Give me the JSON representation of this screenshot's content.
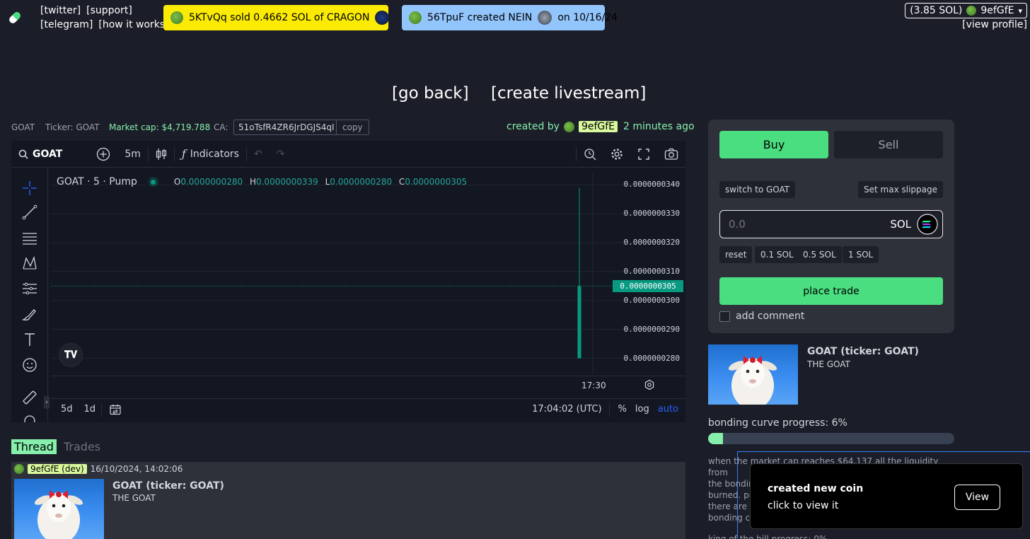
{
  "nav": {
    "links_row1": [
      "[twitter]",
      "[support]"
    ],
    "links_row2": [
      "[telegram]",
      "[how it works]"
    ],
    "ticker_sale": {
      "text": "5KTvQq  sold 0.4662 SOL of CRAGON",
      "bg": "#fbeb04"
    },
    "ticker_create": {
      "text": "56TpuF created NEIN",
      "date": "on 10/16/24",
      "bg": "#93c5fd"
    },
    "wallet": {
      "balance": "(3.85 SOL)",
      "user": "9efGfE",
      "caret": "▾"
    },
    "view_profile": "[view profile]"
  },
  "actions": {
    "go_back": "[go back]",
    "create_livestream": "[create livestream]"
  },
  "coin": {
    "name": "GOAT",
    "ticker_label": "Ticker: GOAT",
    "market_cap": "Market cap: $4,719.788",
    "ca_label": "CA:",
    "ca_value": "51oTsfR4ZR6JrDGJS4qI",
    "copy_label": "copy",
    "created_by": "created by",
    "creator": "9efGfE",
    "created_ago": "2 minutes ago"
  },
  "chart_toolbar": {
    "symbol": "GOAT",
    "interval": "5m",
    "indicators": "Indicators"
  },
  "chart_data": {
    "type": "candlestick",
    "title": "GOAT · 5 · Pump",
    "ohlc": {
      "O": "0.0000000280",
      "H": "0.0000000339",
      "L": "0.0000000280",
      "C": "0.0000000305"
    },
    "candles": [
      {
        "time": "17:00",
        "open": 2.8e-08,
        "high": 3.39e-08,
        "low": 2.8e-08,
        "close": 3.05e-08
      }
    ],
    "y_ticks": [
      "0.0000000340",
      "0.0000000330",
      "0.0000000320",
      "0.0000000310",
      "0.0000000300",
      "0.0000000290",
      "0.0000000280"
    ],
    "ylim": [
      2.745e-08,
      3.445e-08
    ],
    "last_price": "0.0000000305",
    "x_ticks": [
      "17:30"
    ],
    "up_color": "#089981"
  },
  "chart_bottom": {
    "range_5d": "5d",
    "range_1d": "1d",
    "clock": "17:04:02 (UTC)",
    "pct": "%",
    "log": "log",
    "auto": "auto"
  },
  "tabs": {
    "thread": "Thread",
    "trades": "Trades"
  },
  "thread_post": {
    "author": "9efGfE (dev)",
    "timestamp": "16/10/2024, 14:02:06",
    "title": "GOAT (ticker: GOAT)",
    "desc": "THE GOAT"
  },
  "trade": {
    "buy": "Buy",
    "sell": "Sell",
    "switch": "switch to GOAT",
    "slippage": "Set max slippage",
    "amount_placeholder": "0.0",
    "currency": "SOL",
    "quick": [
      "reset",
      "0.1 SOL",
      "0.5 SOL",
      "1 SOL"
    ],
    "place": "place trade",
    "add_comment": "add comment"
  },
  "coin_card": {
    "title": "GOAT (ticker: GOAT)",
    "desc": "THE GOAT"
  },
  "bonding": {
    "label": "bonding curve progress: 6%",
    "progress": 0.06,
    "para1_l1": "when the market cap reaches $64,137 all the liquidity from",
    "para1_l2": "the bondin",
    "para1_l3": "burned. pr",
    "para2_l1": "there are 7",
    "para2_l2": "bonding cu",
    "para3": "king of the hill progress: 0%"
  },
  "toast": {
    "title": "created new coin",
    "sub": "click to view it",
    "view": "View"
  }
}
